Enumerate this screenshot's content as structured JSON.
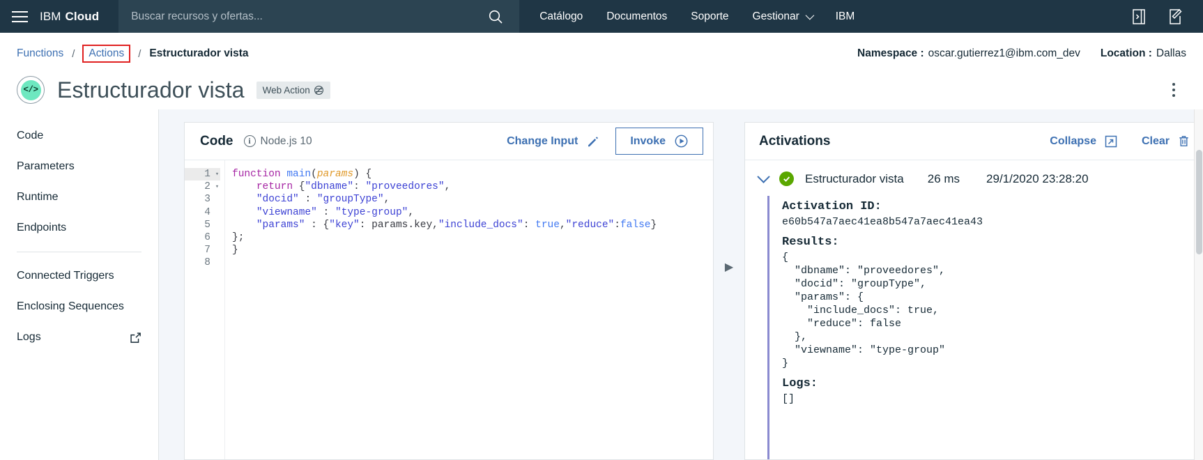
{
  "topnav": {
    "menu_icon": "hamburger-menu-icon",
    "brand_ibm": "IBM",
    "brand_cloud": "Cloud",
    "search_placeholder": "Buscar recursos y ofertas...",
    "search_value": "",
    "search_icon": "search-icon",
    "links": [
      {
        "label": "Catálogo",
        "caret": false
      },
      {
        "label": "Documentos",
        "caret": false
      },
      {
        "label": "Soporte",
        "caret": false
      },
      {
        "label": "Gestionar",
        "caret": true
      },
      {
        "label": "IBM",
        "caret": false
      }
    ],
    "right_icons": [
      {
        "name": "shell-terminal-icon"
      },
      {
        "name": "compose-edit-icon"
      }
    ]
  },
  "breadcrumb": {
    "items": [
      {
        "label": "Functions",
        "current": false,
        "highlighted": false
      },
      {
        "label": "Actions",
        "current": false,
        "highlighted": true
      },
      {
        "label": "Estructurador vista",
        "current": true,
        "highlighted": false
      }
    ],
    "separator": "/",
    "highlight_color": "#e02020"
  },
  "meta": {
    "namespace_label": "Namespace :",
    "namespace_value": "oscar.gutierrez1@ibm.com_dev",
    "location_label": "Location :",
    "location_value": "Dallas"
  },
  "title": {
    "icon_glyph": "</>",
    "icon_name": "code-action-icon",
    "icon_color": "#6ee8c0",
    "text": "Estructurador vista",
    "web_action_tag": "Web Action",
    "web_action_icon": "web-action-slashed-icon",
    "overflow_menu": "overflow-menu-icon"
  },
  "sidebar": {
    "items": [
      {
        "label": "Code",
        "icon": null
      },
      {
        "label": "Parameters",
        "icon": null
      },
      {
        "label": "Runtime",
        "icon": null
      },
      {
        "label": "Endpoints",
        "icon": null
      }
    ],
    "items2": [
      {
        "label": "Connected Triggers",
        "icon": null
      },
      {
        "label": "Enclosing Sequences",
        "icon": null
      },
      {
        "label": "Logs",
        "icon": "external-link-icon"
      }
    ]
  },
  "code_panel": {
    "title": "Code",
    "info_icon": "info-icon",
    "runtime": "Node.js 10",
    "change_input_label": "Change Input",
    "change_input_icon": "pencil-edit-icon",
    "invoke_label": "Invoke",
    "invoke_icon": "play-circle-icon",
    "line_numbers": [
      "1",
      "2",
      "3",
      "4",
      "5",
      "6",
      "7",
      "8"
    ],
    "foldable_lines": [
      "1",
      "2"
    ],
    "active_line": "1",
    "lines": [
      "function main(params) {",
      "    return {\"dbname\": \"proveedores\",",
      "    \"docid\" : \"groupType\",",
      "    \"viewname\" : \"type-group\",",
      "    \"params\" : {\"key\": params.key,\"include_docs\": true,\"reduce\":false}",
      "};",
      "}",
      ""
    ]
  },
  "panel_divider": {
    "expand_icon": "expand-right-triangle-icon"
  },
  "activations": {
    "title": "Activations",
    "collapse_label": "Collapse",
    "collapse_icon": "collapse-icon",
    "clear_label": "Clear",
    "clear_icon": "trash-icon",
    "row": {
      "chevron_icon": "chevron-down-icon",
      "status_icon": "success-check-icon",
      "status_color": "#5aa700",
      "name": "Estructurador vista",
      "duration": "26 ms",
      "timestamp": "29/1/2020 23:28:20"
    },
    "detail": {
      "activation_id_label": "Activation ID:",
      "activation_id": "e60b547a7aec41ea8b547a7aec41ea43",
      "results_label": "Results:",
      "results": "{\n  \"dbname\": \"proveedores\",\n  \"docid\": \"groupType\",\n  \"params\": {\n    \"include_docs\": true,\n    \"reduce\": false\n  },\n  \"viewname\": \"type-group\"\n}",
      "logs_label": "Logs:",
      "logs": "[]"
    }
  }
}
